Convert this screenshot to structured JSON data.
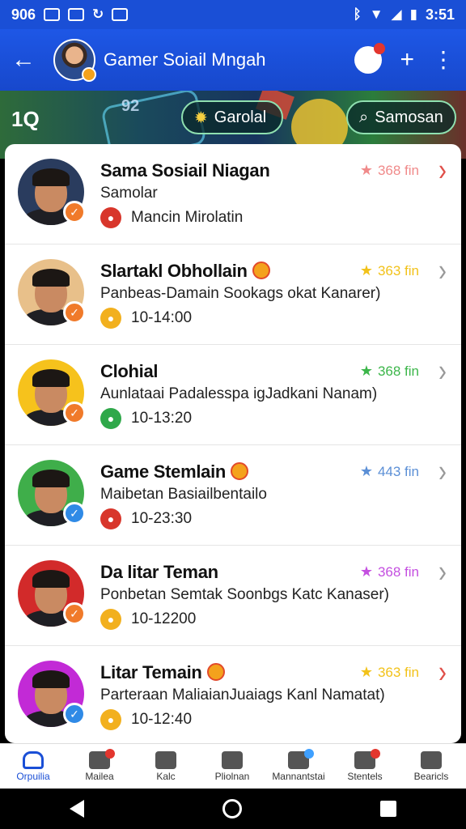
{
  "status_bar": {
    "left_text": "906",
    "time": "3:51"
  },
  "app_bar": {
    "title": "Gamer Soiail Mngah"
  },
  "banner": {
    "count": "1Q",
    "score": "92",
    "pill_one": "Garolal",
    "pill_two": "Samosan"
  },
  "conversations": [
    {
      "name": "Sama Sosiail Niagan",
      "subtitle": "Samolar",
      "meta": "Mancin Mirolatin",
      "rating": "368 fin",
      "star_color": "#f08a8a",
      "meta_icon_color": "#d8362b",
      "check_color": "#f07a2a",
      "avatar_bg": "#2a3c5e",
      "has_emoji": false,
      "chevron_color": "#e0504a"
    },
    {
      "name": "Slartakl Obhollain",
      "subtitle": "Panbeas-Damain Sookags okat Kanarer)",
      "meta": "10-14:00",
      "rating": "363 fin",
      "star_color": "#f2c21a",
      "meta_icon_color": "#f2b01e",
      "check_color": "#f07a2a",
      "avatar_bg": "#e8c08a",
      "has_emoji": true,
      "chevron_color": "#999999"
    },
    {
      "name": "Clohial",
      "subtitle": "Aunlataai Padalesspa igJadkani Nanam)",
      "meta": "10-13:20",
      "rating": "368 fin",
      "star_color": "#3cb64a",
      "meta_icon_color": "#2fa84a",
      "check_color": "#f07a2a",
      "avatar_bg": "#f6c21c",
      "has_emoji": false,
      "chevron_color": "#999999"
    },
    {
      "name": "Game Stemlain",
      "subtitle": "Maibetan Basiailbentailo",
      "meta": "10-23:30",
      "rating": "443 fin",
      "star_color": "#5b8fd6",
      "meta_icon_color": "#d8362b",
      "check_color": "#2f8ae6",
      "avatar_bg": "#3fae4a",
      "has_emoji": true,
      "chevron_color": "#999999"
    },
    {
      "name": "Da litar Teman",
      "subtitle": "Ponbetan Semtak Soonbgs Katc Kanaser)",
      "meta": "10-12200",
      "rating": "368 fin",
      "star_color": "#c44fe0",
      "meta_icon_color": "#f2b01e",
      "check_color": "#f07a2a",
      "avatar_bg": "#d22a2a",
      "has_emoji": false,
      "chevron_color": "#999999"
    },
    {
      "name": "Litar Temain",
      "subtitle": "Parteraan MaliaianJuaiags Kanl Namatat)",
      "meta": "10-12:40",
      "rating": "363 fin",
      "star_color": "#f2c21a",
      "meta_icon_color": "#f2b01e",
      "check_color": "#2f8ae6",
      "avatar_bg": "#c22ad6",
      "has_emoji": true,
      "chevron_color": "#e0504a"
    }
  ],
  "bottom_nav": [
    {
      "label": "Orpuilia",
      "icon": "home-icon",
      "active": true,
      "dot": ""
    },
    {
      "label": "Mailea",
      "icon": "mail-icon",
      "active": false,
      "dot": "red"
    },
    {
      "label": "Kalc",
      "icon": "search-icon",
      "active": false,
      "dot": ""
    },
    {
      "label": "Pliolnan",
      "icon": "calendar-icon",
      "active": false,
      "dot": ""
    },
    {
      "label": "Mannantstai",
      "icon": "gamepad-icon",
      "active": false,
      "dot": "blue"
    },
    {
      "label": "Stentels",
      "icon": "message-icon",
      "active": false,
      "dot": "red"
    },
    {
      "label": "Bearicls",
      "icon": "profile-icon",
      "active": false,
      "dot": ""
    }
  ]
}
